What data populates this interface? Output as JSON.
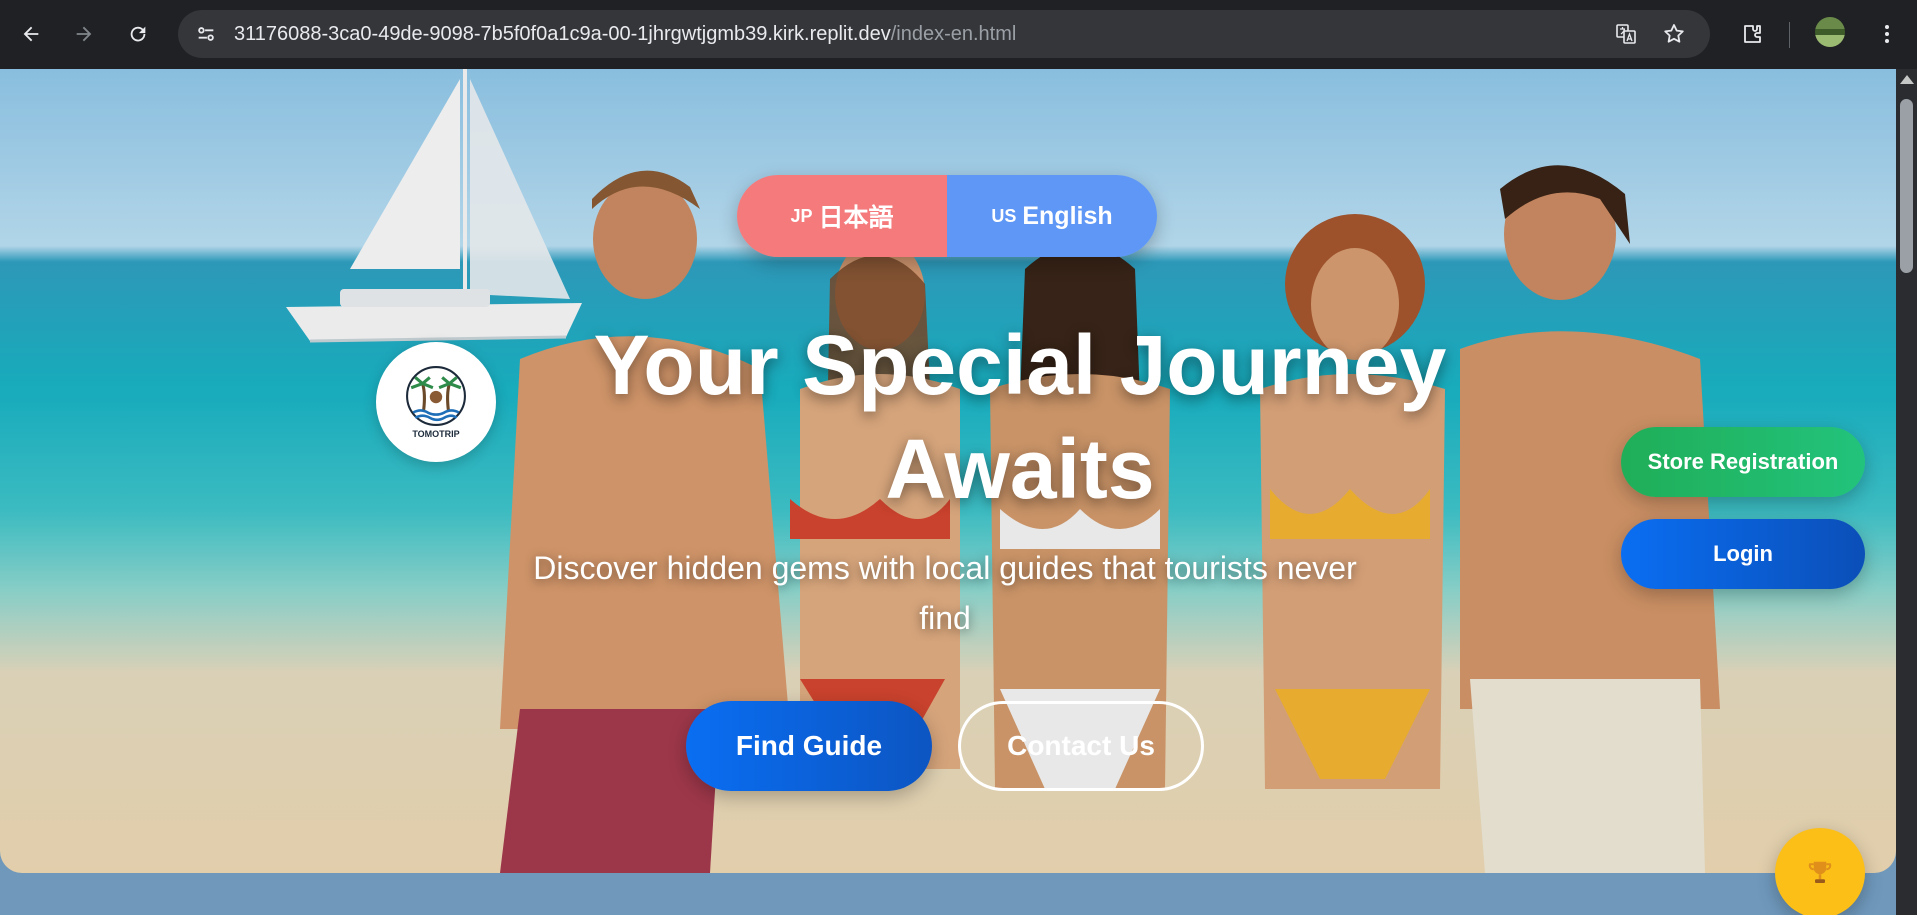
{
  "browser": {
    "url_host": "31176088-3ca0-49de-9098-7b5f0f0a1c9a-00-1jhrgwtjgmb39.kirk.replit.dev",
    "url_path": "/index-en.html",
    "icons": [
      "back-icon",
      "forward-icon",
      "reload-icon",
      "site-info-icon",
      "translate-icon",
      "bookmark-star-icon",
      "extensions-icon",
      "profile-avatar",
      "menu-kebab-icon"
    ]
  },
  "hero": {
    "language_switch": {
      "jp_code": "JP",
      "jp_label": "日本語",
      "en_code": "US",
      "en_label": "English"
    },
    "logo_text": "TOMOTRIP",
    "title": "Your Special Journey Awaits",
    "subtitle": "Discover hidden gems with local guides that tourists never find",
    "find_guide_label": "Find Guide",
    "contact_label": "Contact Us",
    "store_registration_label": "Store Registration",
    "login_label": "Login"
  },
  "colors": {
    "jp_button": "#f47a7c",
    "en_button": "#5e97f5",
    "primary_blue": "#0a6ef2",
    "store_green": "#20ae58",
    "trophy_gold": "#fbbf18"
  }
}
